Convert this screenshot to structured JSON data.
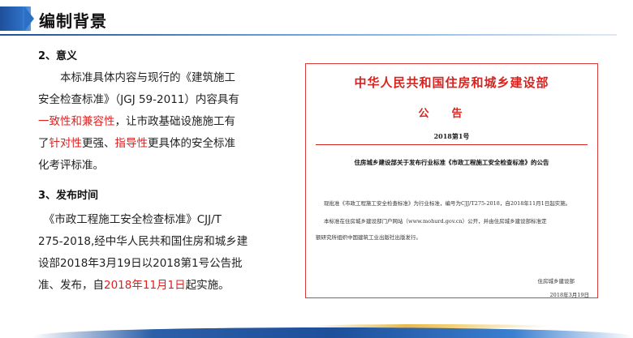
{
  "header": {
    "title": "编制背景"
  },
  "section1": {
    "heading": "2、意义",
    "lines": [
      {
        "parts": [
          {
            "t": "　　本标准具体内容与现行的《建筑施工",
            "hl": false
          }
        ]
      },
      {
        "parts": [
          {
            "t": "安全检查标准》（JGJ 59-2011）内容具有",
            "hl": false
          }
        ]
      },
      {
        "parts": [
          {
            "t": "一致性和兼容性",
            "hl": true
          },
          {
            "t": "，让市政基础设施施工有",
            "hl": false
          }
        ]
      },
      {
        "parts": [
          {
            "t": "了",
            "hl": false
          },
          {
            "t": "针对性",
            "hl": true
          },
          {
            "t": "更强、",
            "hl": false
          },
          {
            "t": "指导性",
            "hl": true
          },
          {
            "t": "更具体的安全标准",
            "hl": false
          }
        ]
      },
      {
        "parts": [
          {
            "t": "化考评标准。",
            "hl": false
          }
        ]
      }
    ]
  },
  "section2": {
    "heading": "3、发布时间",
    "lines": [
      {
        "parts": [
          {
            "t": "　《市政工程施工安全检查标准》CJJ/T",
            "hl": false
          }
        ]
      },
      {
        "parts": [
          {
            "t": "275-2018,经中华人民共和国住房和城乡建",
            "hl": false
          }
        ]
      },
      {
        "parts": [
          {
            "t": "设部2018年3月19日以2018第1号公告批",
            "hl": false
          }
        ]
      },
      {
        "parts": [
          {
            "t": "准、发布，自",
            "hl": false
          },
          {
            "t": "2018年11月1日",
            "hl": true
          },
          {
            "t": "起实施。",
            "hl": false
          }
        ]
      }
    ]
  },
  "notice": {
    "issuer": "中华人民共和国住房和城乡建设部",
    "gonggao": "公告",
    "number": "2018第1号",
    "subject": "住房城乡建设部关于发布行业标准《市政工程施工安全检查标准》的公告",
    "body1": "现批准《市政工程施工安全检查标准》为行业标准，编号为CJJ/T275-2018，自2018年11月1日起实施。",
    "body2a": "本标准在住房城乡建设部门户网站（www.mohurd.gov.cn）公开，并由住房城乡建设部标准定",
    "body2b": "额研究所组织中国建筑工业出版社出版发行。",
    "signature": "住房城乡建设部",
    "date": "2018年3月19日"
  },
  "colors": {
    "accent": "#1e4f9a",
    "highlight": "#e02020",
    "notice_red": "#d8231f"
  }
}
